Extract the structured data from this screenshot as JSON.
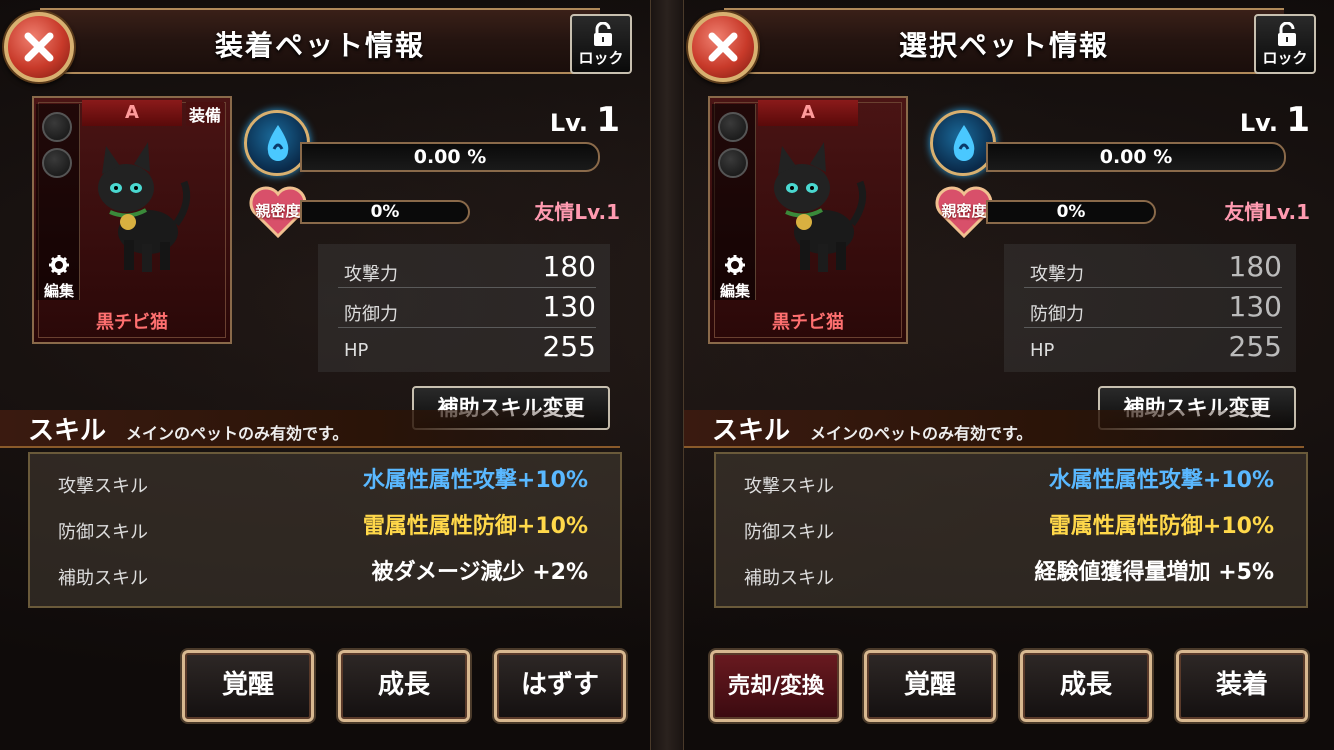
{
  "colors": {
    "water_skill": "#5ab8ff",
    "defense_skill": "#ffd84a",
    "support_skill": "#ffffff",
    "rank": "#ff9a9a",
    "pet_name": "#ff7070",
    "friend": "#ff9ab0"
  },
  "left": {
    "title": "装着ペット情報",
    "lock_label": "ロック",
    "card": {
      "rank": "A",
      "equip_badge": "装備",
      "edit_label": "編集",
      "pet_name": "黒チビ猫"
    },
    "level_prefix": "Lv.",
    "level": "1",
    "exp": "0.00 %",
    "exp_fraction": 0,
    "affinity_label": "親密度",
    "affinity": "0%",
    "affinity_fraction": 0,
    "friend_level": "友情Lv.1",
    "stats": [
      {
        "label": "攻撃力",
        "value": "180"
      },
      {
        "label": "防御力",
        "value": "130"
      },
      {
        "label": "HP",
        "value": "255"
      }
    ],
    "support_change_btn": "補助スキル変更",
    "skills_title": "スキル",
    "skills_sub": "メインのペットのみ有効です。",
    "skills": [
      {
        "name": "攻撃スキル",
        "value": "水属性属性攻撃+10%"
      },
      {
        "name": "防御スキル",
        "value": "雷属性属性防御+10%"
      },
      {
        "name": "補助スキル",
        "value": "被ダメージ減少 +2%"
      }
    ],
    "buttons": [
      "覚醒",
      "成長",
      "はずす"
    ]
  },
  "right": {
    "title": "選択ペット情報",
    "lock_label": "ロック",
    "card": {
      "rank": "A",
      "edit_label": "編集",
      "pet_name": "黒チビ猫"
    },
    "level_prefix": "Lv.",
    "level": "1",
    "exp": "0.00 %",
    "exp_fraction": 0,
    "affinity_label": "親密度",
    "affinity": "0%",
    "affinity_fraction": 0,
    "friend_level": "友情Lv.1",
    "stats": [
      {
        "label": "攻撃力",
        "value": "180"
      },
      {
        "label": "防御力",
        "value": "130"
      },
      {
        "label": "HP",
        "value": "255"
      }
    ],
    "support_change_btn": "補助スキル変更",
    "skills_title": "スキル",
    "skills_sub": "メインのペットのみ有効です。",
    "skills": [
      {
        "name": "攻撃スキル",
        "value": "水属性属性攻撃+10%"
      },
      {
        "name": "防御スキル",
        "value": "雷属性属性防御+10%"
      },
      {
        "name": "補助スキル",
        "value": "経験値獲得量増加 +5%"
      }
    ],
    "buttons": [
      "売却/変換",
      "覚醒",
      "成長",
      "装着"
    ]
  }
}
